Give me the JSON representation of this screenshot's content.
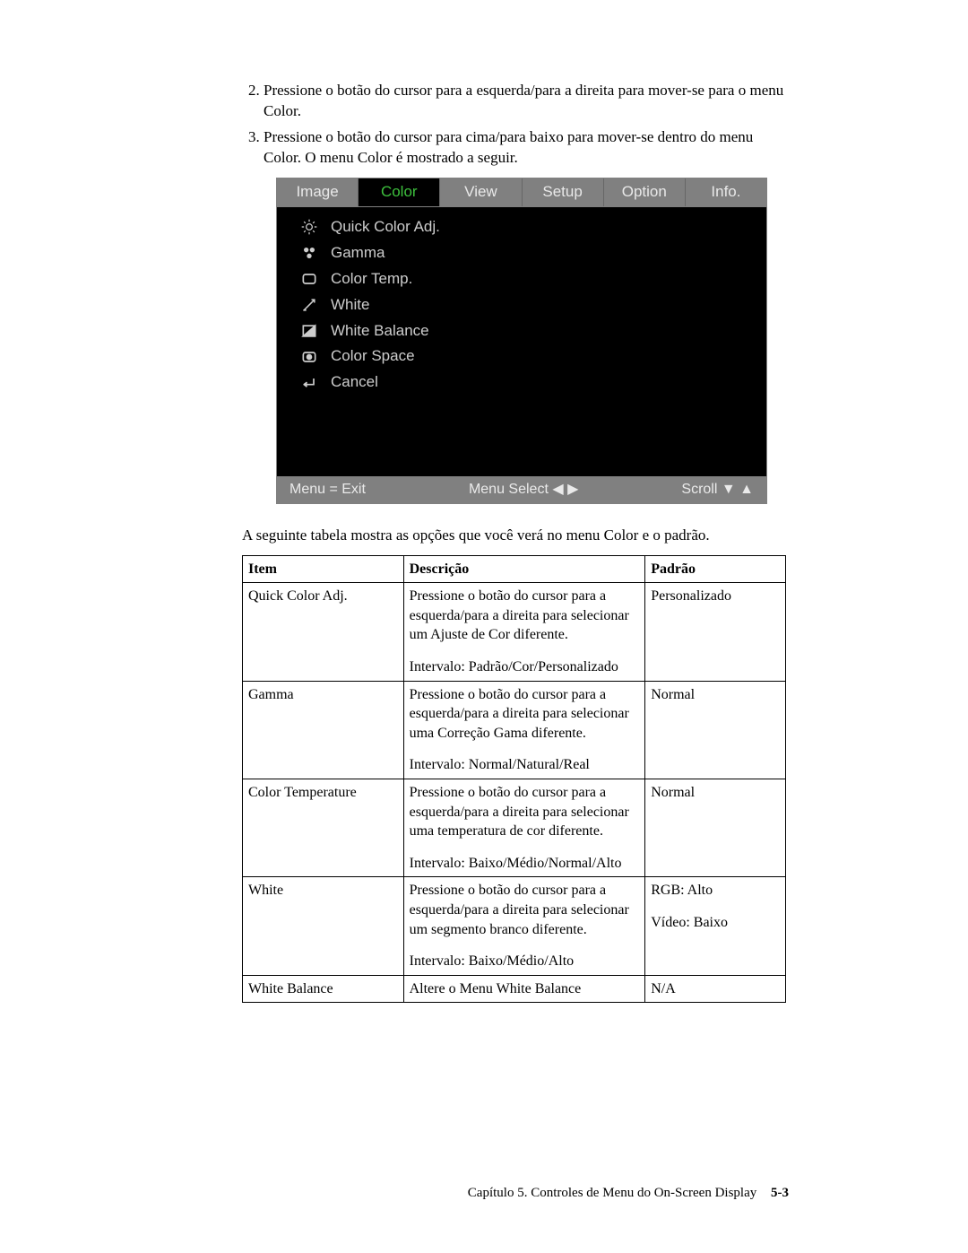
{
  "steps": [
    {
      "n": 2,
      "text": "Pressione o botão do cursor para a esquerda/para a direita para mover-se para o menu Color."
    },
    {
      "n": 3,
      "text": "Pressione o botão do cursor para cima/para baixo para mover-se dentro do menu Color. O menu Color é mostrado a seguir."
    }
  ],
  "osd": {
    "tabs": [
      "Image",
      "Color",
      "View",
      "Setup",
      "Option",
      "Info."
    ],
    "active_tab_index": 1,
    "items": [
      {
        "icon": "sun",
        "label": "Quick Color Adj."
      },
      {
        "icon": "gamma",
        "label": "Gamma"
      },
      {
        "icon": "temp",
        "label": "Color Temp."
      },
      {
        "icon": "white",
        "label": "White"
      },
      {
        "icon": "wb",
        "label": "White Balance"
      },
      {
        "icon": "space",
        "label": "Color Space"
      },
      {
        "icon": "back",
        "label": "Cancel"
      }
    ],
    "footer": {
      "left": "Menu = Exit",
      "mid": "Menu Select ◀ ▶",
      "right": "Scroll ▼ ▲"
    }
  },
  "table_intro": "A seguinte tabela mostra as opções que você verá no menu Color e o padrão.",
  "table": {
    "headers": [
      "Item",
      "Descrição",
      "Padrão"
    ],
    "rows": [
      {
        "item": "Quick Color Adj.",
        "desc1": "Pressione o botão do cursor para a esquerda/para a direita para selecionar um Ajuste de Cor diferente.",
        "desc2": "Intervalo: Padrão/Cor/Personalizado",
        "default1": "Personalizado",
        "default2": ""
      },
      {
        "item": "Gamma",
        "desc1": "Pressione o botão do cursor para a esquerda/para a direita para selecionar uma Correção Gama diferente.",
        "desc2": "Intervalo: Normal/Natural/Real",
        "default1": "Normal",
        "default2": ""
      },
      {
        "item": "Color Temperature",
        "desc1": "Pressione o botão do cursor para a esquerda/para a direita para selecionar uma temperatura de cor diferente.",
        "desc2": "Intervalo: Baixo/Médio/Normal/Alto",
        "default1": "Normal",
        "default2": ""
      },
      {
        "item": "White",
        "desc1": "Pressione o botão do cursor para a esquerda/para a direita para selecionar um segmento branco diferente.",
        "desc2": "Intervalo: Baixo/Médio/Alto",
        "default1": "RGB: Alto",
        "default2": "Vídeo: Baixo"
      },
      {
        "item": "White Balance",
        "desc1": "Altere o Menu White Balance",
        "desc2": "",
        "default1": "N/A",
        "default2": ""
      }
    ]
  },
  "footer": {
    "chapter": "Capítulo 5. Controles de Menu do On-Screen Display",
    "page": "5-3"
  }
}
